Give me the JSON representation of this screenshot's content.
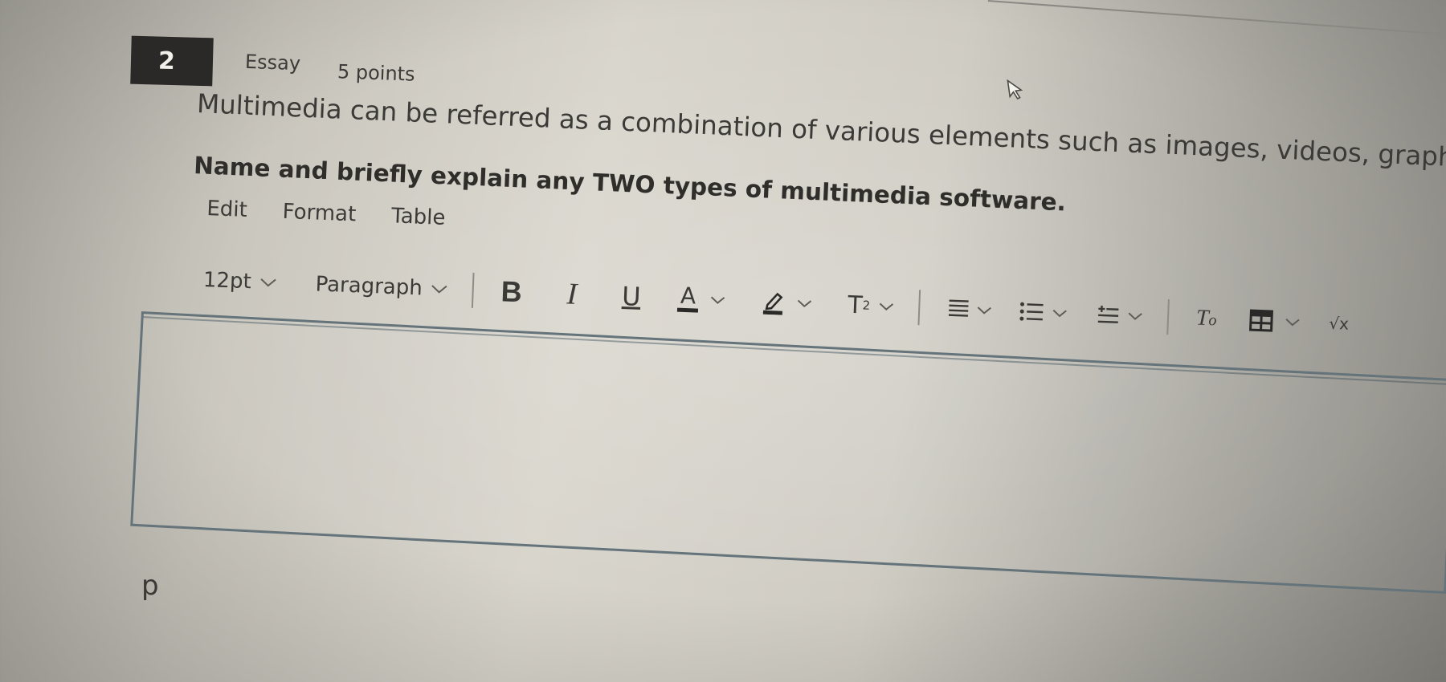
{
  "question": {
    "number": "2",
    "type": "Essay",
    "points": "5 points",
    "prompt_line1": "Multimedia can be referred as a combination of various elements such as images, videos, graphics and so on.",
    "prompt_line2": "Name and briefly explain any TWO types of multimedia software."
  },
  "menu": {
    "edit": "Edit",
    "format": "Format",
    "table": "Table"
  },
  "toolbar": {
    "font_size": "12pt",
    "block_format": "Paragraph",
    "bold": "B",
    "italic": "I",
    "underline": "U",
    "text_color": "A",
    "superscript": "T",
    "superscript_exp": "2",
    "clear_format": "T",
    "math": "√x",
    "icons": [
      "chevron-down-icon",
      "highlight-pen-icon",
      "align-icon",
      "bullet-list-icon",
      "indent-icon",
      "clear-formatting-icon",
      "table-grid-icon",
      "math-equation-icon"
    ],
    "colors": {
      "text_color_bar": "#2a2927",
      "highlight_bar": "#2a2927"
    }
  },
  "editor": {
    "content": "",
    "status_path": "p"
  }
}
